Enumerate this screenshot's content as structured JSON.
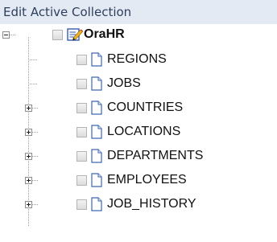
{
  "header": {
    "title": "Edit Active Collection"
  },
  "tree": {
    "root": {
      "label": "OraHR",
      "expander": "minus",
      "icon": "edit-collection-icon",
      "checked": false
    },
    "items": [
      {
        "label": "REGIONS",
        "expander": "none",
        "icon": "document-icon",
        "checked": false
      },
      {
        "label": "JOBS",
        "expander": "none",
        "icon": "document-icon",
        "checked": false
      },
      {
        "label": "COUNTRIES",
        "expander": "plus",
        "icon": "document-icon",
        "checked": false
      },
      {
        "label": "LOCATIONS",
        "expander": "plus",
        "icon": "document-icon",
        "checked": false
      },
      {
        "label": "DEPARTMENTS",
        "expander": "plus",
        "icon": "document-icon",
        "checked": false
      },
      {
        "label": "EMPLOYEES",
        "expander": "plus",
        "icon": "document-icon",
        "checked": false
      },
      {
        "label": "JOB_HISTORY",
        "expander": "plus",
        "icon": "document-icon",
        "checked": false
      }
    ]
  }
}
